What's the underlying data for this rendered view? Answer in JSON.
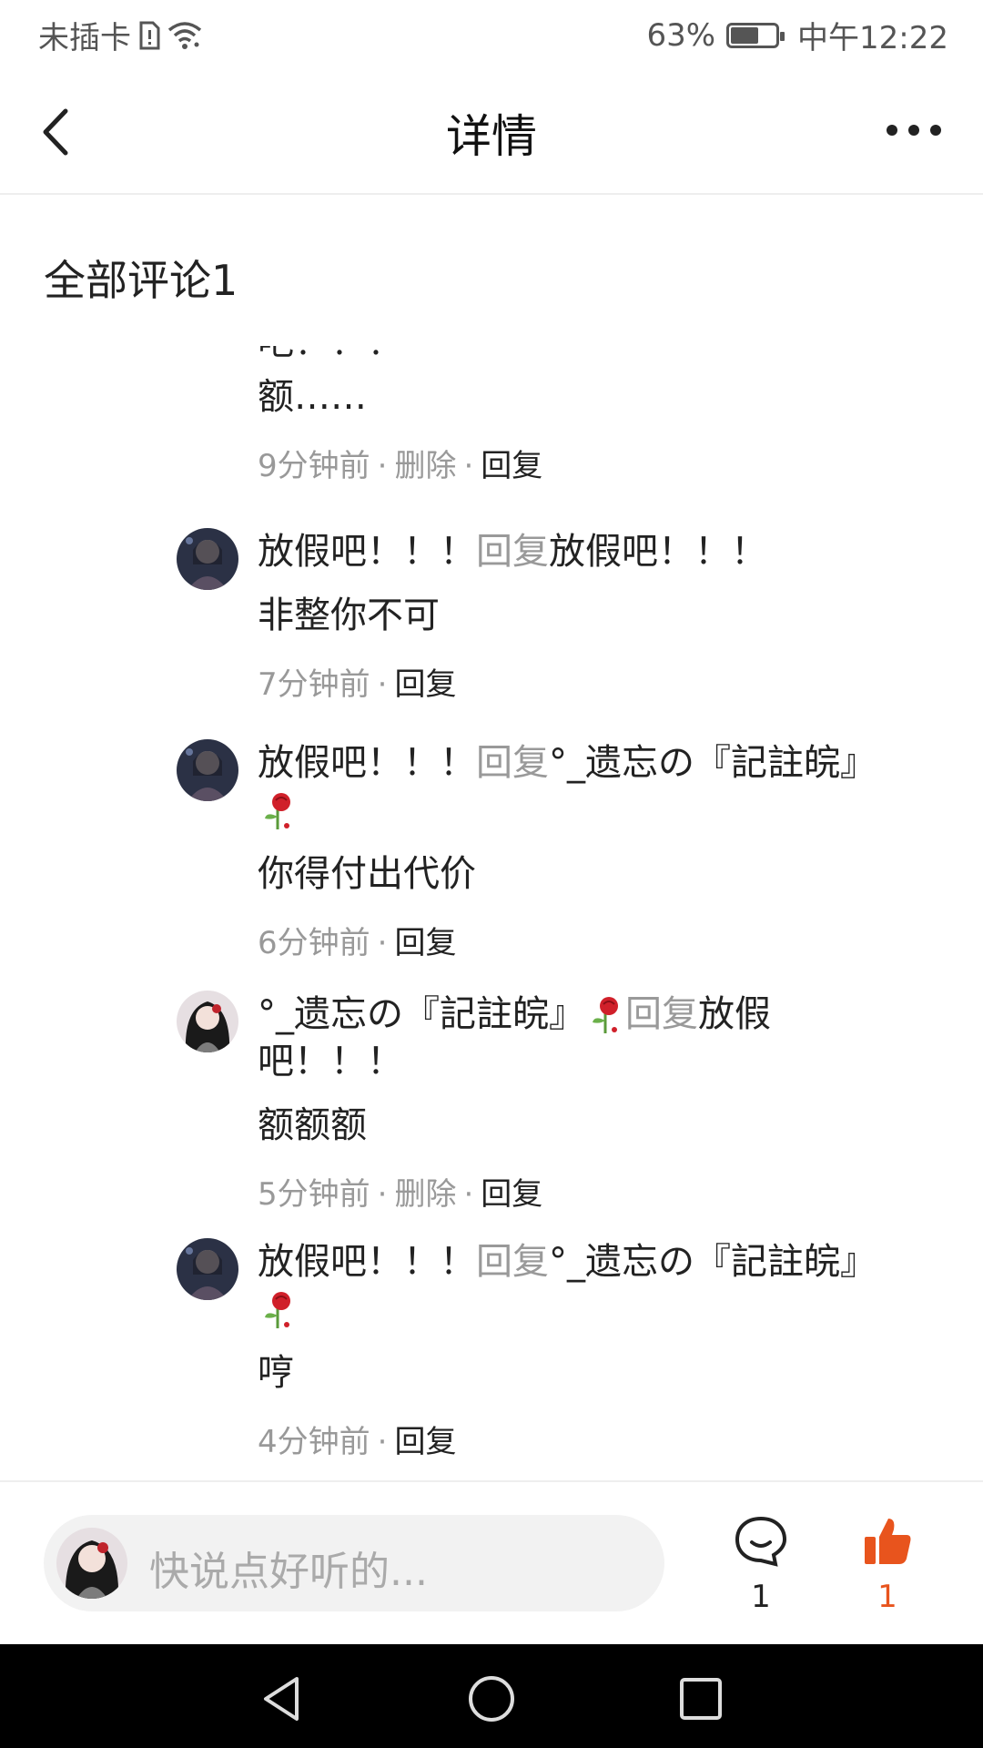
{
  "status_bar": {
    "carrier": "未插卡",
    "battery": "63%",
    "battery_level": 0.63,
    "time": "中午12:22"
  },
  "nav": {
    "title": "详情"
  },
  "section": {
    "title": "全部评论1"
  },
  "comments": [
    {
      "text_partial": "吧！！！",
      "text": "额……",
      "time": "9分钟前",
      "delete_label": "删除",
      "reply_label": "回复"
    },
    {
      "author": "放假吧！！！",
      "reply_word": "回复",
      "target": "放假吧！！！",
      "text": "非整你不可",
      "time": "7分钟前",
      "reply_label": "回复"
    },
    {
      "author": "放假吧！！！",
      "reply_word": "回复",
      "target": "°_遗忘の『記註皖』",
      "text": "你得付出代价",
      "time": "6分钟前",
      "reply_label": "回复"
    },
    {
      "author": "°_遗忘の『記註皖』",
      "reply_word": "回复",
      "target": "放假吧！！！",
      "text": "额额额",
      "time": "5分钟前",
      "delete_label": "删除",
      "reply_label": "回复"
    },
    {
      "author": "放假吧！！！",
      "reply_word": "回复",
      "target": "°_遗忘の『記註皖』",
      "text": "哼",
      "time": "4分钟前",
      "reply_label": "回复"
    }
  ],
  "bottom": {
    "placeholder": "快说点好听的...",
    "comment_count": "1",
    "like_count": "1"
  },
  "colors": {
    "accent": "#e8541d",
    "muted": "#999999",
    "text": "#222222"
  }
}
